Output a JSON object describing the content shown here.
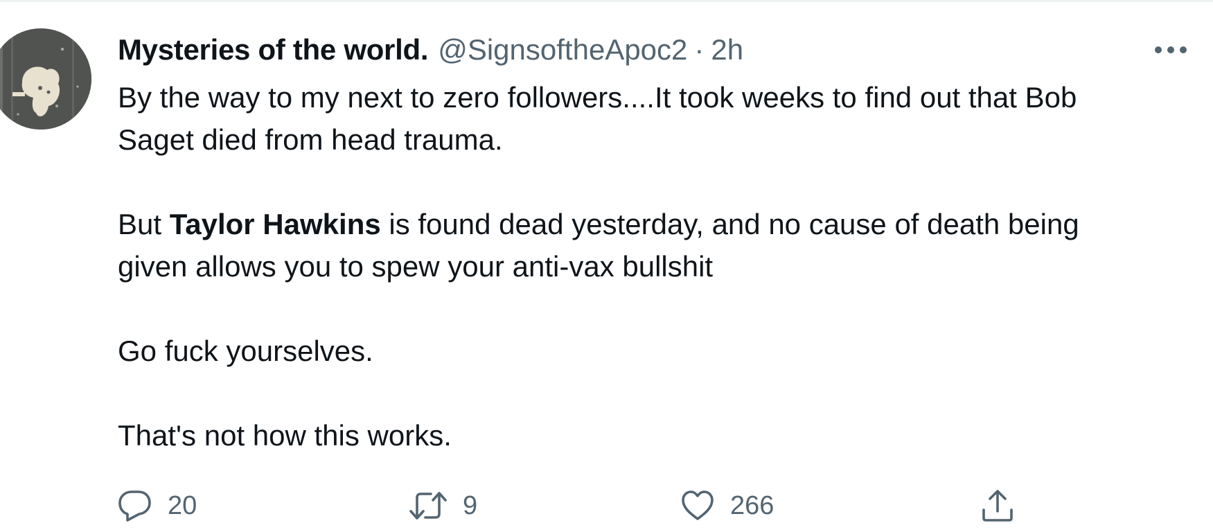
{
  "tweet": {
    "display_name": "Mysteries of the world.",
    "handle": "@SignsoftheApoc2",
    "separator": "·",
    "time": "2h",
    "body": {
      "line1": "By the way to my next to zero followers....It took weeks to find out that Bob",
      "line2": "Saget died from head trauma.",
      "p2_prefix": "But ",
      "p2_bold": "Taylor Hawkins",
      "p2_rest": " is found dead yesterday, and no cause of death being",
      "p2_line2": "given allows you to spew your anti-vax bullshit",
      "p3": "Go fuck yourselves.",
      "p4": "That's not how this works."
    },
    "actions": {
      "reply_count": "20",
      "retweet_count": "9",
      "like_count": "266"
    }
  },
  "icons": {
    "more": "more-horizontal-icon",
    "reply": "reply-bubble-icon",
    "retweet": "retweet-icon",
    "like": "heart-icon",
    "share": "share-upload-icon"
  },
  "colors": {
    "text_primary": "#0f1419",
    "text_secondary": "#536471",
    "divider": "#eff3f4"
  }
}
